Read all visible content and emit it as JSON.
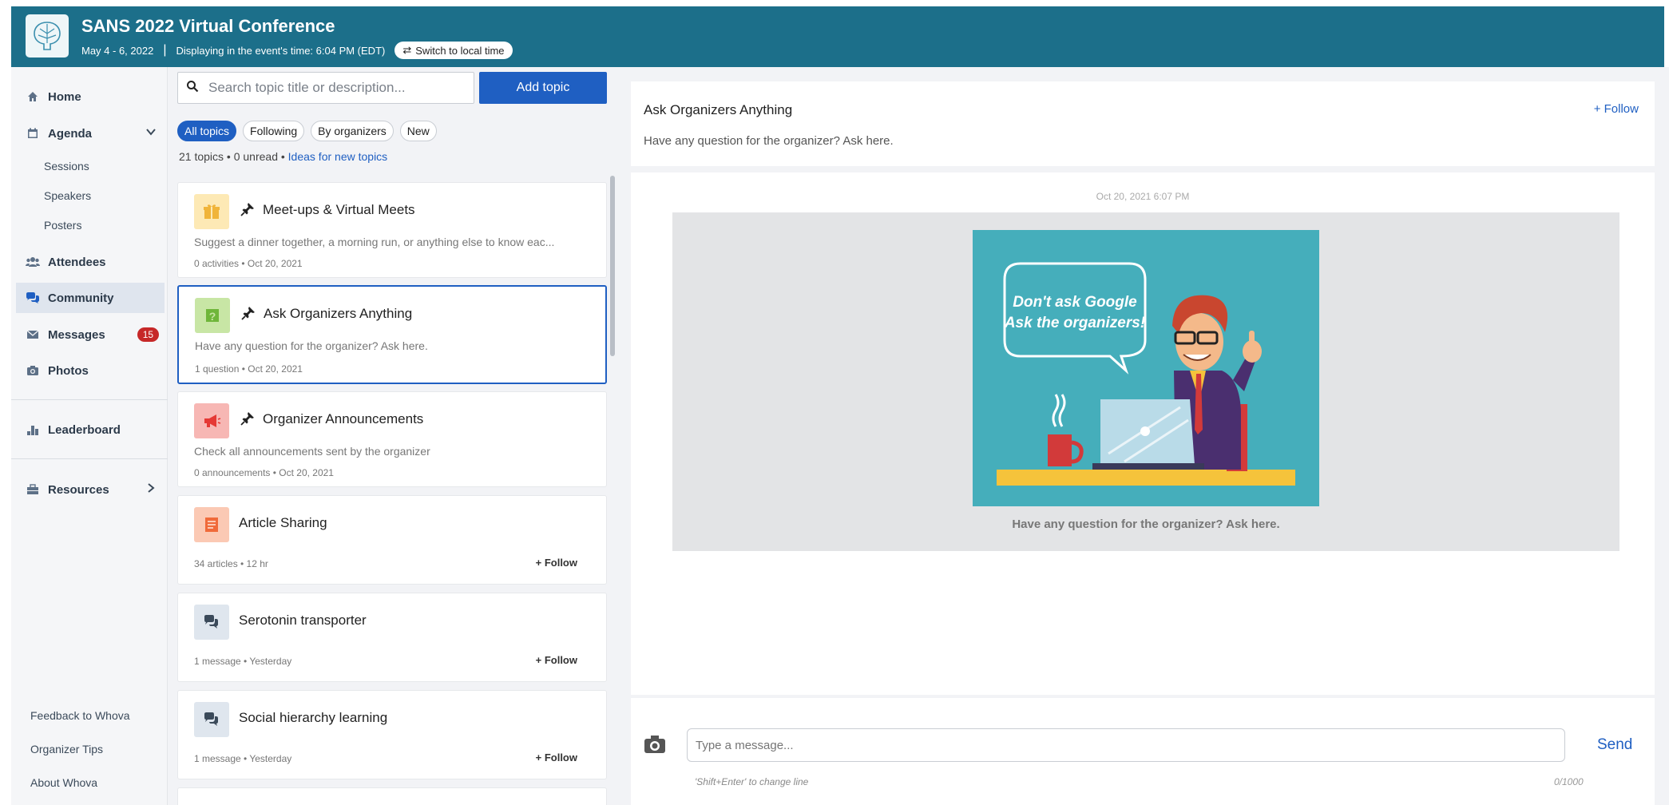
{
  "header": {
    "title": "SANS 2022 Virtual Conference",
    "dates": "May 4 - 6, 2022",
    "separator": "|",
    "time_display": "Displaying in the event's time: 6:04 PM (EDT)",
    "switch_label": "Switch to local time"
  },
  "sidebar": {
    "home": "Home",
    "agenda": "Agenda",
    "sessions": "Sessions",
    "speakers": "Speakers",
    "posters": "Posters",
    "attendees": "Attendees",
    "community": "Community",
    "messages": "Messages",
    "messages_badge": "15",
    "photos": "Photos",
    "leaderboard": "Leaderboard",
    "resources": "Resources",
    "feedback": "Feedback to Whova",
    "organizer_tips": "Organizer Tips",
    "about": "About Whova"
  },
  "topics": {
    "search_placeholder": "Search topic title or description...",
    "add_topic": "Add topic",
    "filters": [
      "All topics",
      "Following",
      "By organizers",
      "New"
    ],
    "counts": "21 topics • 0 unread •",
    "ideas_link": "Ideas for new topics",
    "items": [
      {
        "title": "Meet-ups & Virtual Meets",
        "desc": "Suggest a dinner together, a morning run, or anything else to know eac...",
        "meta": "0 activities • Oct 20, 2021",
        "icon": "gift-icon",
        "icon_color": "#fde9b5"
      },
      {
        "title": "Ask Organizers Anything",
        "desc": "Have any question for the organizer? Ask here.",
        "meta": "1 question • Oct 20, 2021",
        "icon": "question-icon",
        "icon_color": "#c8e6a5"
      },
      {
        "title": "Organizer Announcements",
        "desc": "Check all announcements sent by the organizer",
        "meta": "0 announcements • Oct 20, 2021",
        "icon": "megaphone-icon",
        "icon_color": "#f7b7b4"
      },
      {
        "title": "Article Sharing",
        "meta": "34 articles • 12 hr",
        "follow": "Follow",
        "icon": "article-icon",
        "icon_color": "#fbc9b4"
      },
      {
        "title": "Serotonin transporter",
        "meta": "1 message • Yesterday",
        "follow": "Follow",
        "icon": "chat-icon",
        "icon_color": "#dfe6ee"
      },
      {
        "title": "Social hierarchy learning",
        "meta": "1 message • Yesterday",
        "follow": "Follow",
        "icon": "chat-icon",
        "icon_color": "#dfe6ee"
      }
    ]
  },
  "detail": {
    "title": "Ask Organizers Anything",
    "follow": "Follow",
    "description": "Have any question for the organizer? Ask here.",
    "timestamp": "Oct 20, 2021 6:07 PM",
    "bubble_line1": "Don't ask Google",
    "bubble_line2": "Ask the organizers!",
    "caption": "Have any question for the organizer? Ask here.",
    "message_placeholder": "Type a message...",
    "send": "Send",
    "hint": "'Shift+Enter' to change line",
    "char_count": "0/1000"
  },
  "colors": {
    "header": "#1c6f8a",
    "accent": "#1f5fc2",
    "badge": "#c62828"
  }
}
